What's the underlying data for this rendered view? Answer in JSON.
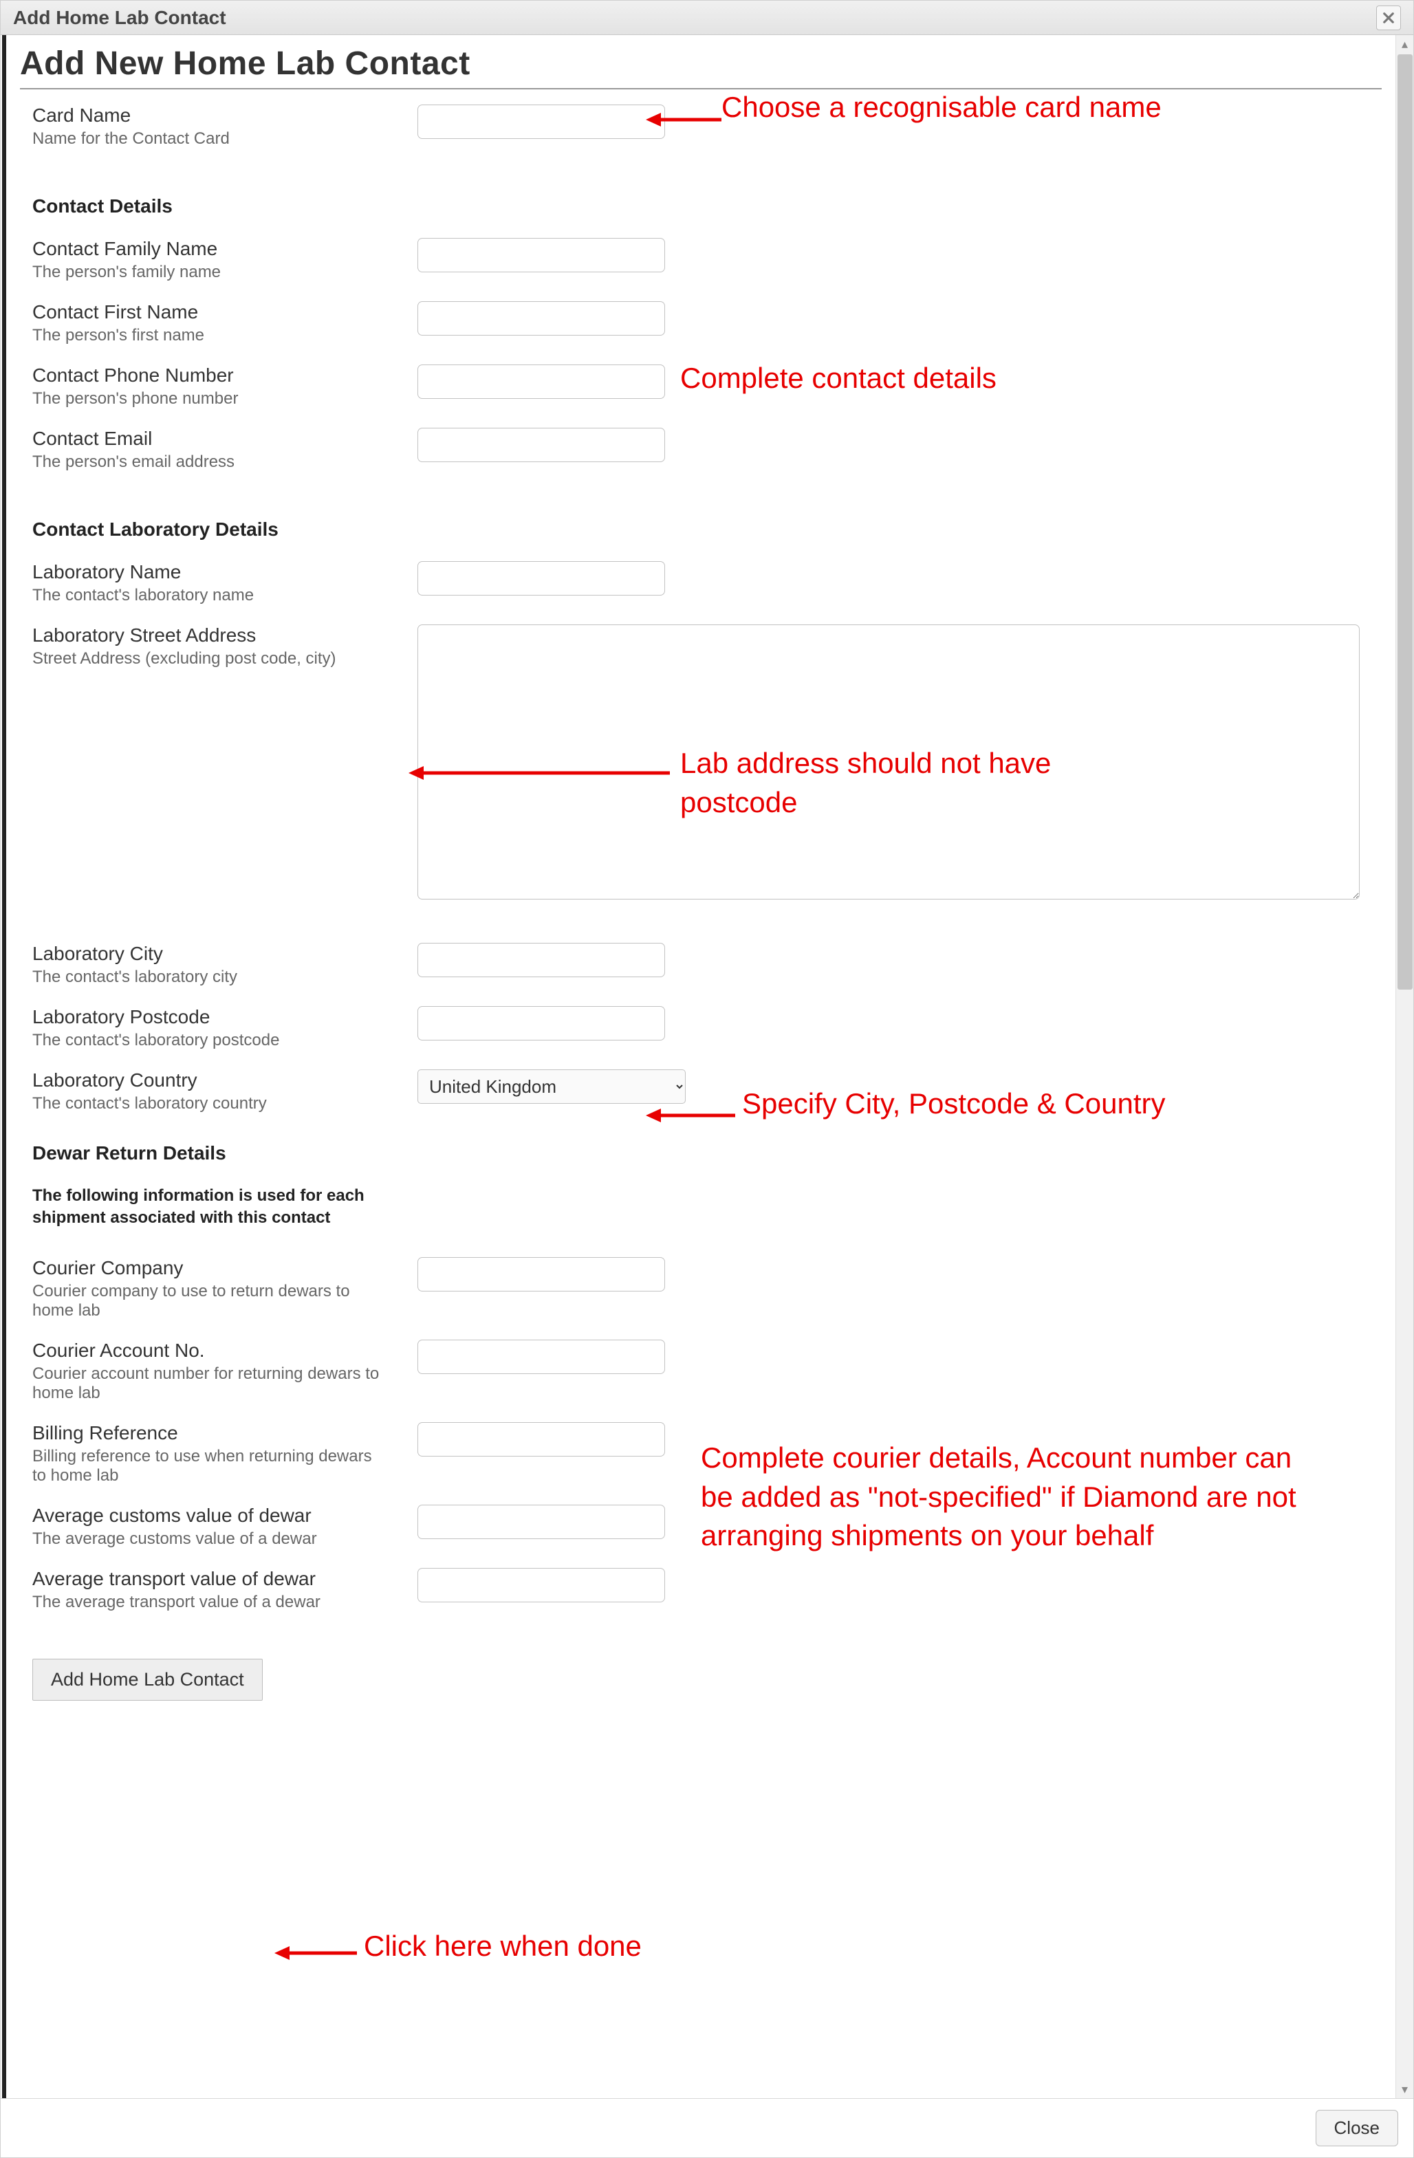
{
  "modal": {
    "header_title": "Add Home Lab Contact",
    "page_title": "Add New Home Lab Contact",
    "submit_label": "Add Home Lab Contact",
    "close_label": "Close"
  },
  "sections": {
    "contact_details": "Contact Details",
    "contact_lab_details": "Contact Laboratory Details",
    "dewar_return": "Dewar Return Details",
    "dewar_return_sub": "The following information is used for each shipment associated with this contact"
  },
  "fields": {
    "card_name": {
      "label": "Card Name",
      "desc": "Name for the Contact Card",
      "value": ""
    },
    "family_name": {
      "label": "Contact Family Name",
      "desc": "The person's family name",
      "value": ""
    },
    "first_name": {
      "label": "Contact First Name",
      "desc": "The person's first name",
      "value": ""
    },
    "phone": {
      "label": "Contact Phone Number",
      "desc": "The person's phone number",
      "value": ""
    },
    "email": {
      "label": "Contact Email",
      "desc": "The person's email address",
      "value": ""
    },
    "lab_name": {
      "label": "Laboratory Name",
      "desc": "The contact's laboratory name",
      "value": ""
    },
    "lab_address": {
      "label": "Laboratory Street Address",
      "desc": "Street Address (excluding post code, city)",
      "value": ""
    },
    "lab_city": {
      "label": "Laboratory City",
      "desc": "The contact's laboratory city",
      "value": ""
    },
    "lab_postcode": {
      "label": "Laboratory Postcode",
      "desc": "The contact's laboratory postcode",
      "value": ""
    },
    "lab_country": {
      "label": "Laboratory Country",
      "desc": "The contact's laboratory country",
      "value": "United Kingdom"
    },
    "courier_company": {
      "label": "Courier Company",
      "desc": "Courier company to use to return dewars to home lab",
      "value": ""
    },
    "courier_account": {
      "label": "Courier Account No.",
      "desc": "Courier account number for returning dewars to home lab",
      "value": ""
    },
    "billing_ref": {
      "label": "Billing Reference",
      "desc": "Billing reference to use when returning dewars to home lab",
      "value": ""
    },
    "avg_customs": {
      "label": "Average customs value of dewar",
      "desc": "The average customs value of a dewar",
      "value": ""
    },
    "avg_transport": {
      "label": "Average transport value of dewar",
      "desc": "The average transport value of a dewar",
      "value": ""
    }
  },
  "annotations": {
    "card_name": "Choose a recognisable card name",
    "contact_details": "Complete contact details",
    "lab_address": "Lab address should not have postcode",
    "city_postcode_country": "Specify City, Postcode & Country",
    "courier": "Complete courier details, Account number can be added as \"not-specified\" if Diamond are not arranging shipments on your behalf",
    "submit": "Click here when done"
  },
  "colors": {
    "annotation": "#e70000"
  }
}
